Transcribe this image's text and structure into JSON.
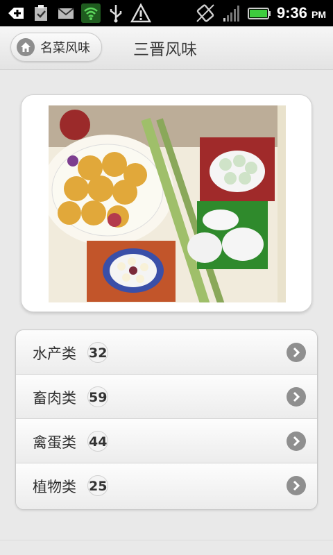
{
  "status_bar": {
    "time": "9:36",
    "ampm": "PM",
    "icons": [
      "add-icon",
      "clipboard-check-icon",
      "gmail-icon",
      "wifi-shield-icon",
      "usb-icon",
      "warning-icon",
      "rotate-icon",
      "signal-icon",
      "battery-icon"
    ]
  },
  "header": {
    "home_label": "名菜风味",
    "title": "三晋风味"
  },
  "image_card": {
    "image": "food-collage"
  },
  "categories": [
    {
      "label": "水产类",
      "count": "32"
    },
    {
      "label": "畜肉类",
      "count": "59"
    },
    {
      "label": "禽蛋类",
      "count": "44"
    },
    {
      "label": "植物类",
      "count": "25"
    }
  ],
  "colors": {
    "background": "#e9e9e9",
    "status_bar": "#000000",
    "chevron": "#8f8f8f"
  }
}
